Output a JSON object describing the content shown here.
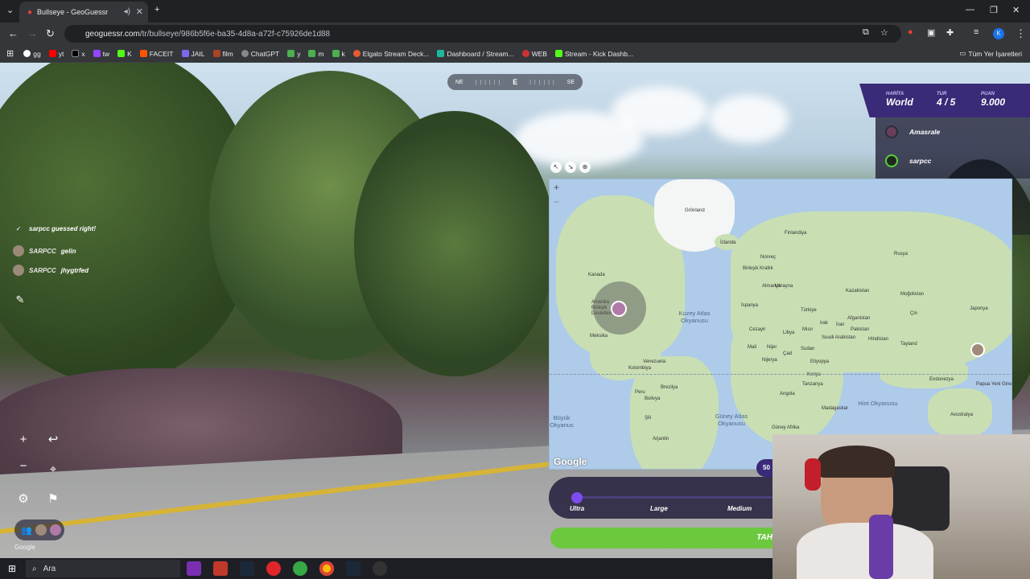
{
  "browser": {
    "tab_title": "Bullseye - GeoGuessr",
    "url_host": "geoguessr.com",
    "url_path": "/tr/bullseye/986b5f6e-ba35-4d8a-a72f-c75926de1d88",
    "bookmarks": [
      "gg",
      "yt",
      "x",
      "tw",
      "K",
      "FACEIT",
      "JAIL",
      "film",
      "ChatGPT",
      "y",
      "m",
      "k",
      "Elgato Stream Deck...",
      "Dashboard / Stream...",
      "WEB",
      "Stream - Kick Dashb..."
    ],
    "all_bookmarks": "Tüm Yer İşaretleri"
  },
  "compass": {
    "left": "NE",
    "center": "E",
    "right": "SE"
  },
  "scoreboard": {
    "map_label": "HARİTA",
    "map_value": "World",
    "round_label": "TUR",
    "round_value": "4 / 5",
    "points_label": "PUAN",
    "points_value": "9.000"
  },
  "players": [
    "Amasrale",
    "sarpcc"
  ],
  "chat": [
    {
      "name": "",
      "message": "sarpcc guessed right!"
    },
    {
      "name": "SARPCC",
      "message": "gelin"
    },
    {
      "name": "SARPCC",
      "message": "jhygtrfed"
    }
  ],
  "map": {
    "labels": {
      "greenland": "Grönland",
      "iceland": "İzlanda",
      "finland": "Finlandiya",
      "norway": "Norveç",
      "uk": "Birleşik Krallık",
      "germany": "Almanya",
      "ukraine": "Ukrayna",
      "russia": "Rusya",
      "kazakhstan": "Kazakistan",
      "mongolia": "Moğolistan",
      "china": "Çin",
      "japan": "Japonya",
      "turkey": "Türkiye",
      "spain": "İspanya",
      "afghanistan": "Afganistan",
      "iran": "İran",
      "pakistan": "Pakistan",
      "iraq": "Irak",
      "algeria": "Cezayir",
      "libya": "Libya",
      "egypt": "Mısır",
      "saudi": "Suudi Arabistan",
      "india": "Hindistan",
      "thailand": "Tayland",
      "mali": "Mali",
      "niger": "Nijer",
      "chad": "Çad",
      "sudan": "Sudan",
      "ethiopia": "Etiyopya",
      "nigeria": "Nijerya",
      "kenya": "Kenya",
      "tanzania": "Tanzanya",
      "angola": "Angola",
      "madagascar": "Madagaskar",
      "south_africa": "Güney Afrika",
      "indonesia": "Endonezya",
      "png": "Papua Yeni Gine",
      "australia": "Avustralya",
      "canada": "Kanada",
      "usa": "Amerika Birleşik Devletleri",
      "mexico": "Meksika",
      "venezuela": "Venezuela",
      "colombia": "Kolombiya",
      "peru": "Peru",
      "brazil": "Brezilya",
      "bolivia": "Bolivya",
      "chile": "Şili",
      "argentina": "Arjantin"
    },
    "oceans": {
      "north_atlantic": "Kuzey Atlas Okyanusu",
      "south_atlantic": "Güney Atlas Okyanusu",
      "indian": "Hint Okyanusu",
      "pacific_partial": "Büyük Okyanus"
    },
    "attribution": "Google"
  },
  "guess_size": {
    "options": [
      "Ultra",
      "Large",
      "Medium"
    ],
    "selected": "Ultra",
    "badge": "50"
  },
  "guess_button": "TAH",
  "street_attribution": "Google",
  "taskbar": {
    "search_placeholder": "Ara"
  }
}
